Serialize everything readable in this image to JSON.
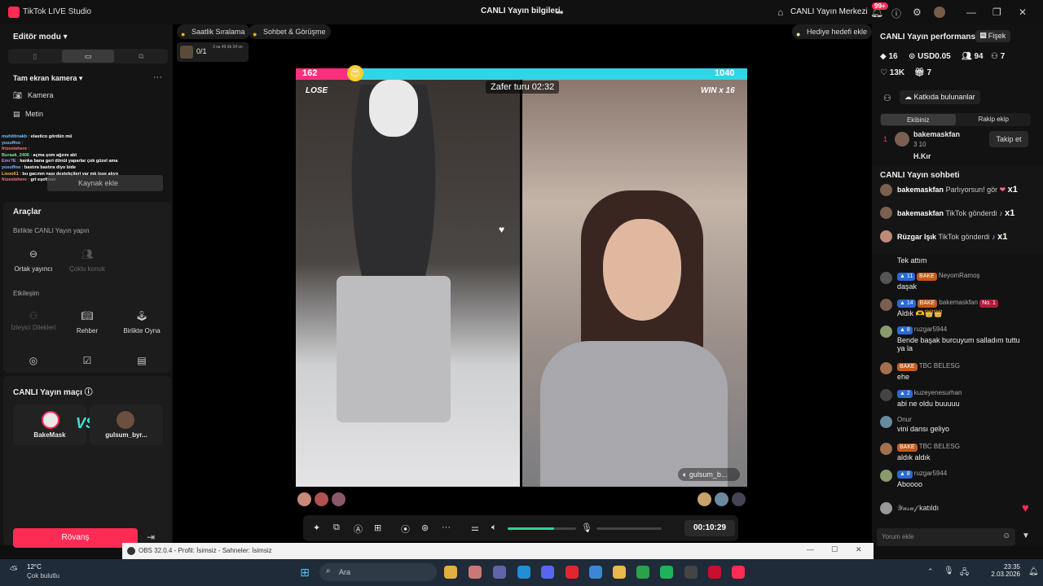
{
  "app": {
    "title": "TikTok LIVE Studio",
    "center_title": "CANLI Yayın bilgileri",
    "merkez": "CANLI Yayın Merkezi",
    "badge": "99+"
  },
  "left": {
    "editor_mode": "Editör modu",
    "camera_section": "Tam ekran kamera",
    "kamera": "Kamera",
    "metin": "Metin",
    "kaynak": "Kaynak ekle",
    "araclar": "Araçlar",
    "birlikte": "Birlikte CANLI Yayın yapın",
    "ortak": "Ortak yayıncı",
    "coklu": "Çoklu konuk",
    "etkilesim": "Etkileşim",
    "izleyici": "İzleyici Dilekleri",
    "rehber": "Rehber",
    "oyna": "Birlikte Oyna",
    "mac": "CANLI Yayın maçı",
    "player1": "BakeMask",
    "player2": "gulsum_byr...",
    "vs": "VS",
    "rovans": "Rövanş"
  },
  "overlay_chat": [
    {
      "u": "muhittinakb",
      "t": "elastico gördün mü"
    },
    {
      "u": "yusuffoo",
      "t": ""
    },
    {
      "u": "frizexiohere",
      "t": ""
    },
    {
      "u": "Buraak_2406",
      "t": "açma şom ağzını abi"
    },
    {
      "u": "Emr?E",
      "t": "kanka bana geri dönüi yaparlar çok güzel ama"
    },
    {
      "u": "yusuffoo",
      "t": "bastıra bastıra diyo bide"
    },
    {
      "u": "Lisoo61",
      "t": "bu gacının nası destekçileri var mk lose alıyo"
    },
    {
      "u": "frizexiohere",
      "t": "gri eşofman"
    }
  ],
  "center": {
    "pill1": "Saatlik Sıralama",
    "pill2": "Sohbet & Görüşme",
    "hediye": "Hediye hedefi ekle",
    "goal": "0/1",
    "goal_time": "3 sa 49 dk 34 sn",
    "score_left": "162",
    "score_right": "1040",
    "zafer": "Zafer turu 02:32",
    "lose": "LOSE",
    "win": "WIN x 16",
    "gulsum": "gulsum_b...",
    "timer": "00:10:29"
  },
  "right": {
    "perf": "CANLI Yayın performansı",
    "fisek": "Fişek",
    "stat1": "16",
    "stat2": "USD0.05",
    "stat3": "94",
    "stat4": "7",
    "stat5": "13K",
    "stat6": "7",
    "contrib": "Katkıda bulunanlar",
    "tab1": "Ekibiniz",
    "tab2": "Rakip ekip",
    "c1_name": "bakemaskfan",
    "c1_stats": "3  10",
    "c2_name": "H.Kır",
    "follow": "Takip et",
    "chat_title": "CANLI Yayın sohbeti"
  },
  "gifts": [
    {
      "name": "bakemaskfan",
      "text": "Parlıyorsun! gör",
      "count": "x1"
    },
    {
      "name": "bakemaskfan",
      "text": "TikTok gönderdi",
      "count": "x1"
    },
    {
      "name": "Rüzgar Işık",
      "text": "TikTok gönderdi",
      "count": "x1"
    }
  ],
  "chat": [
    {
      "badges": [],
      "name": "",
      "text": "Tek attım"
    },
    {
      "badges": [
        "11",
        "BAKE"
      ],
      "name": "NeyomRamoş",
      "text": "daşak"
    },
    {
      "badges": [
        "14",
        "BAKE"
      ],
      "name": "bakemaskfan",
      "extra": "No. 1",
      "text": "Aldık 🫶👑👑"
    },
    {
      "badges": [
        "8"
      ],
      "name": "ruzgar5944",
      "text": "Bende başak burcuyum salladım tuttu ya la"
    },
    {
      "badges": [
        "BAKE"
      ],
      "name": "TBC BELESG",
      "text": "ehe"
    },
    {
      "badges": [
        "2"
      ],
      "name": "kuzeyenesurhan",
      "text": "abi ne oldu buuuuu"
    },
    {
      "badges": [],
      "name": "Onur",
      "text": "vini dansı geliyo"
    },
    {
      "badges": [
        "BAKE"
      ],
      "name": "TBC BELESG",
      "text": "aldık aldık"
    },
    {
      "badges": [
        "8"
      ],
      "name": "ruzgar5944",
      "text": "Aboooo"
    }
  ],
  "joined": {
    "name": "𝒴𝓊𝓈𝓊𝒻",
    "text": "katıldı"
  },
  "input_placeholder": "Yorum ekle",
  "obs": "OBS 32.0.4 - Profil: İsimsiz - Sahneler: İsimsiz",
  "taskbar": {
    "temp": "12°C",
    "weather": "Çok bulutlu",
    "search": "Ara",
    "time": "23:35",
    "date": "2.03.2026"
  },
  "colors": {
    "accent": "#fe2c55",
    "teal": "#30d5e6",
    "pink": "#ff2f7e"
  }
}
